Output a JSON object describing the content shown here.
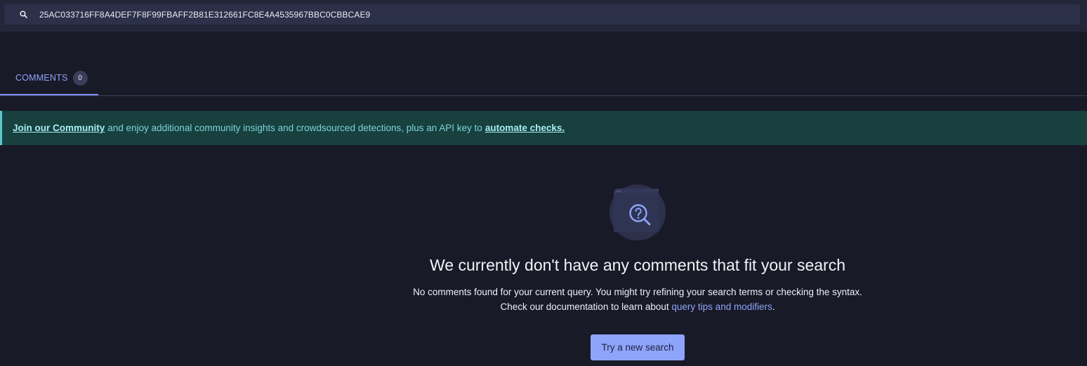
{
  "search": {
    "value": "25AC033716FF8A4DEF7F8F99FBAFF2B81E312661FC8E4A4535967BBC0CBBCAE9",
    "icon": "search-icon"
  },
  "tabs": [
    {
      "label": "COMMENTS",
      "count": "0",
      "active": true
    }
  ],
  "banner": {
    "join_link": "Join our Community",
    "middle_text": "and enjoy additional community insights and crowdsourced detections, plus an API key to",
    "automate_link": "automate checks."
  },
  "empty_state": {
    "icon": "search-question-icon",
    "title": "We currently don't have any comments that fit your search",
    "line1": "No comments found for your current query. You might try refining your search terms or checking the syntax.",
    "line2_prefix": "Check our documentation to learn about",
    "line2_link": "query tips and modifiers",
    "line2_suffix": ".",
    "button_label": "Try a new search"
  },
  "colors": {
    "background": "#191a27",
    "accent": "#8ea4fb",
    "banner_bg": "#17403f",
    "banner_text": "#7ed4d6"
  }
}
